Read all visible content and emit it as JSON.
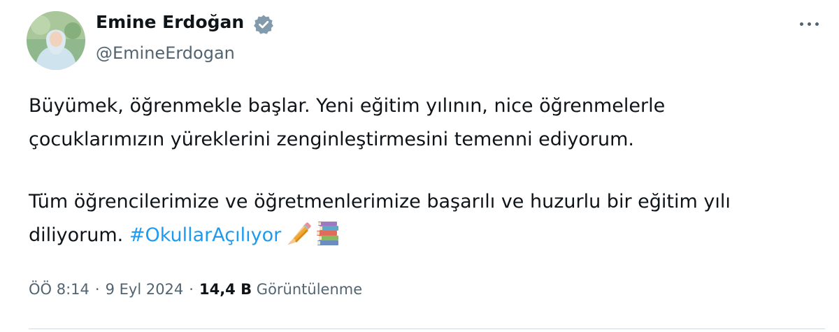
{
  "author": {
    "display_name": "Emine Erdoğan",
    "handle": "@EmineErdogan",
    "verified_icon": "verified-badge-icon",
    "avatar": "author-avatar"
  },
  "post": {
    "paragraph_1_line_1": "Büyümek, öğrenmekle başlar. Yeni eğitim yılının, nice öğrenmelerle",
    "paragraph_1_line_2": "çocuklarımızın yüreklerini zenginleştirmesini temenni ediyorum.",
    "paragraph_2_line_1": "Tüm öğrencilerimize ve öğretmenlerimize başarılı ve huzurlu bir eğitim yılı",
    "paragraph_2_line_2_start": "diliyorum.",
    "hashtag": "#OkullarAçılıyor",
    "emojis": [
      "pencil-icon",
      "books-icon"
    ]
  },
  "meta": {
    "time": "ÖÖ 8:14",
    "separator": "·",
    "date": "9 Eyl 2024",
    "views_count": "14,4 B",
    "views_label": "Görüntülenme"
  },
  "colors": {
    "accent": "#1d9bf0",
    "text": "#0f1419",
    "secondary": "#536471",
    "divider": "#cfd9de"
  }
}
